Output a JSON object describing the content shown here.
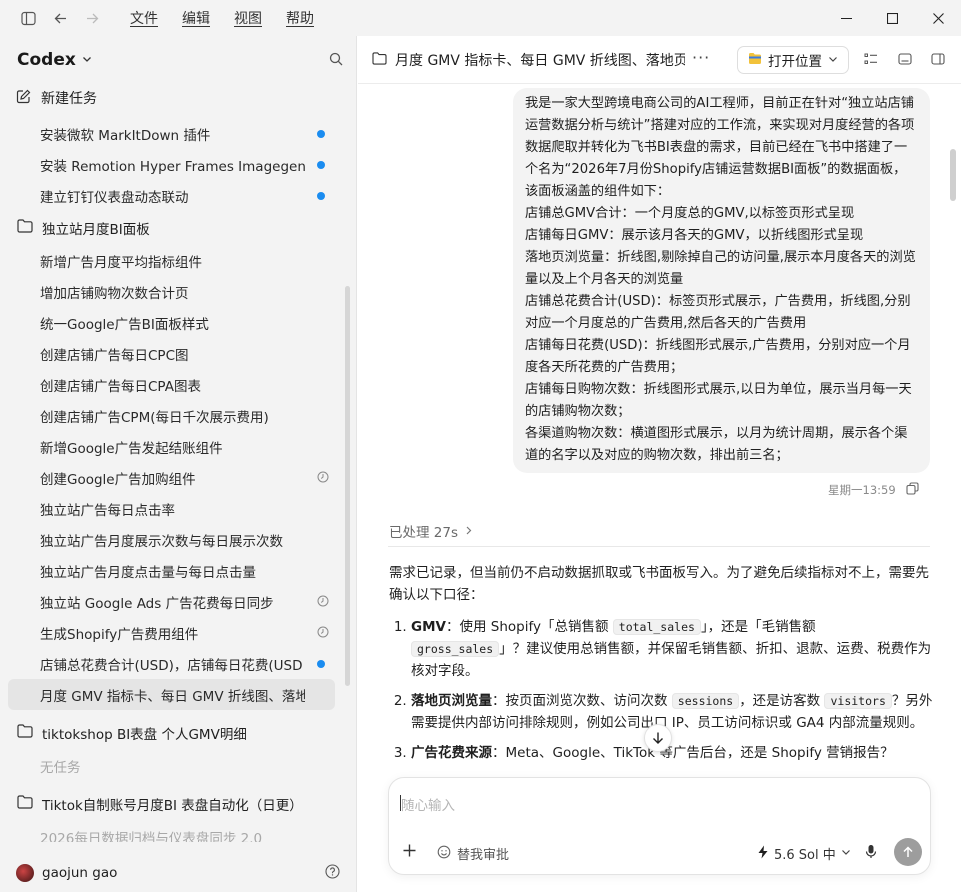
{
  "menu": [
    "文件",
    "编辑",
    "视图",
    "帮助"
  ],
  "sidebar": {
    "app_name": "Codex",
    "new_task": "新建任务",
    "top_items": [
      {
        "label": "安装微软 MarkItDown 插件",
        "status": "dot"
      },
      {
        "label": "安装 Remotion Hyper Frames Imagegen",
        "status": "dot"
      },
      {
        "label": "建立钉钉仪表盘动态联动",
        "status": "dot"
      }
    ],
    "group1": {
      "label": "独立站月度BI面板",
      "items": [
        {
          "label": "新增广告月度平均指标组件",
          "status": ""
        },
        {
          "label": "增加店铺购物次数合计页",
          "status": ""
        },
        {
          "label": "统一Google广告BI面板样式",
          "status": ""
        },
        {
          "label": "创建店铺广告每日CPC图",
          "status": ""
        },
        {
          "label": "创建店铺广告每日CPA图表",
          "status": ""
        },
        {
          "label": "创建店铺广告CPM(每日千次展示费用)",
          "status": ""
        },
        {
          "label": "新增Google广告发起结账组件",
          "status": ""
        },
        {
          "label": "创建Google广告加购组件",
          "status": "clock"
        },
        {
          "label": "独立站广告每日点击率",
          "status": ""
        },
        {
          "label": "独立站广告月度展示次数与每日展示次数",
          "status": ""
        },
        {
          "label": "独立站广告月度点击量与每日点击量",
          "status": ""
        },
        {
          "label": "独立站 Google Ads 广告花费每日同步",
          "status": "clock"
        },
        {
          "label": "生成Shopify广告费用组件",
          "status": "clock"
        },
        {
          "label": "店铺总花费合计(USD)，店铺每日花费(USD",
          "status": "dot"
        },
        {
          "label": "月度 GMV 指标卡、每日 GMV 折线图、落地页",
          "status": "active"
        }
      ]
    },
    "group2": {
      "label": "tiktokshop BI表盘 个人GMV明细",
      "empty": "无任务"
    },
    "group3": {
      "label": "Tiktok自制账号月度BI 表盘自动化（日更）",
      "faded_item": "2026每日数据归档与仪表盘同步 2.0"
    },
    "user": "gaojun gao"
  },
  "main": {
    "title": "月度 GMV 指标卡、每日 GMV 折线图、落地页",
    "open_location": "打开位置",
    "user_message": [
      "我是一家大型跨境电商公司的AI工程师，目前正在针对“独立站店铺运营数据分析与统计”搭建对应的工作流，来实现对月度经营的各项数据爬取并转化为飞书BI表盘的需求，目前已经在飞书中搭建了一个名为“2026年7月份Shopify店铺运营数据BI面板”的数据面板，该面板涵盖的组件如下：",
      "店铺总GMV合计：一个月度总的GMV,以标签页形式呈现",
      "店铺每日GMV：展示该月各天的GMV，以折线图形式呈现",
      "落地页浏览量：折线图,剔除掉自己的访问量,展示本月度各天的浏览量以及上个月各天的浏览量",
      "店铺总花费合计(USD)：标签页形式展示，广告费用，折线图,分别对应一个月度总的广告费用,然后各天的广告费用",
      "店铺每日花费(USD)：折线图形式展示,广告费用，分别对应一个月度各天所花费的广告费用；",
      "店铺每日购物次数：折线图形式展示,以日为单位，展示当月每一天的店铺购物次数；",
      "各渠道购物次数：横道图形式展示，以月为统计周期，展示各个渠道的名字以及对应的购物次数，排出前三名；"
    ],
    "message_time": "星期一13:59",
    "processed": "已处理 27s",
    "reply_intro": "需求已记录，但当前仍不启动数据抓取或飞书面板写入。为了避免后续指标对不上，需要先确认以下口径：",
    "reply_items": [
      {
        "bold": "GMV",
        "text_a": "：使用 Shopify「总销售额 ",
        "code_a": "total_sales",
        "text_b": "」，还是「毛销售额 ",
        "code_b": "gross_sales",
        "text_c": "」？建议使用总销售额，并保留毛销售额、折扣、退款、运费、税费作为核对字段。"
      },
      {
        "bold": "落地页浏览量",
        "text_a": "：按页面浏览次数、访问次数 ",
        "code_a": "sessions",
        "text_b": "，还是访客数 ",
        "code_b": "visitors",
        "text_c": "？另外需要提供内部访问排除规则，例如公司出口 IP、员工访问标识或 GA4 内部流量规则。"
      },
      {
        "bold": "广告花费来源",
        "text_a": "：Meta、Google、TikTok 等广告后台，还是 Shopify 营销报告？",
        "code_a": "",
        "text_b": "",
        "code_b": "",
        "text_c": ""
      }
    ],
    "composer": {
      "placeholder": "随心输入",
      "approve": "替我审批",
      "model": "5.6 Sol 中"
    }
  }
}
